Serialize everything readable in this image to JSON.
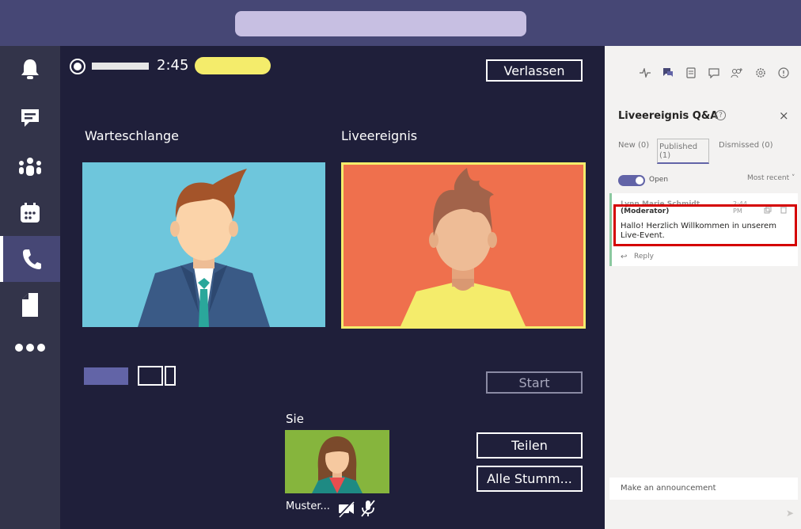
{
  "meeting": {
    "timer": "2:45",
    "leave_label": "Verlassen",
    "queue_label": "Warteschlange",
    "live_label": "Liveereignis",
    "start_label": "Start",
    "self_label": "Sie",
    "self_name": "Muster...",
    "share_label": "Teilen",
    "mute_all_label": "Alle Stumm..."
  },
  "rail": {
    "icons": [
      "bell-icon",
      "chat-icon",
      "teams-icon",
      "calendar-icon",
      "phone-icon",
      "file-icon",
      "more-icon"
    ],
    "active": "phone-icon"
  },
  "panel": {
    "title": "Liveereignis Q&A",
    "help": "?",
    "close": "×",
    "tabs": {
      "new": "New (0)",
      "published": "Published (1)",
      "dismissed": "Dismissed (0)"
    },
    "toggle_label": "Open",
    "sort_label": "Most recent ˅",
    "question": {
      "author": "Lynn Marie Schmidt",
      "role": "(Moderator)",
      "time": "2:44 PM",
      "message": "Hallo! Herzlich Willkommen in unserem Live-Event.",
      "reply_label": "Reply"
    },
    "announce_placeholder": "Make an announcement"
  },
  "colors": {
    "accent": "#6264a7",
    "stage_bg": "#1f1f3a",
    "rail_bg": "#33344a",
    "topbar_bg": "#464775",
    "live_frame": "#f4ec6b",
    "highlight": "#d40000"
  }
}
